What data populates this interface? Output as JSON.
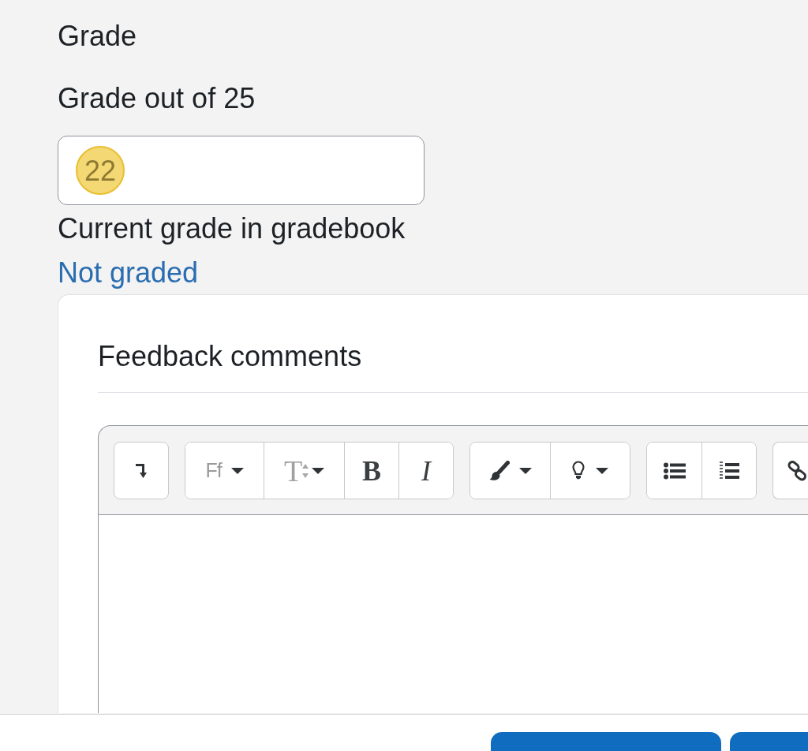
{
  "section": {
    "title": "Grade"
  },
  "grade": {
    "label": "Grade out of 25",
    "value": "22",
    "highlighted": true,
    "current_label": "Current grade in gradebook",
    "current_value": "Not graded"
  },
  "feedback": {
    "title": "Feedback comments",
    "toolbar": [
      {
        "buttons": [
          {
            "kind": "collapse",
            "dropdown": false
          }
        ]
      },
      {
        "buttons": [
          {
            "kind": "font",
            "label": "Ff",
            "dropdown": true
          },
          {
            "kind": "size",
            "label": "T",
            "dropdown": true
          },
          {
            "kind": "bold",
            "label": "B",
            "dropdown": false
          },
          {
            "kind": "italic",
            "label": "I",
            "dropdown": false
          }
        ]
      },
      {
        "buttons": [
          {
            "kind": "color",
            "dropdown": true
          },
          {
            "kind": "highlight",
            "dropdown": true
          }
        ]
      },
      {
        "buttons": [
          {
            "kind": "bullets",
            "dropdown": false
          },
          {
            "kind": "numbers",
            "dropdown": false
          }
        ]
      },
      {
        "buttons": [
          {
            "kind": "link",
            "dropdown": false
          }
        ]
      }
    ]
  },
  "footer": {
    "buttons": [
      {
        "kind": "primary"
      },
      {
        "kind": "primary"
      }
    ]
  }
}
